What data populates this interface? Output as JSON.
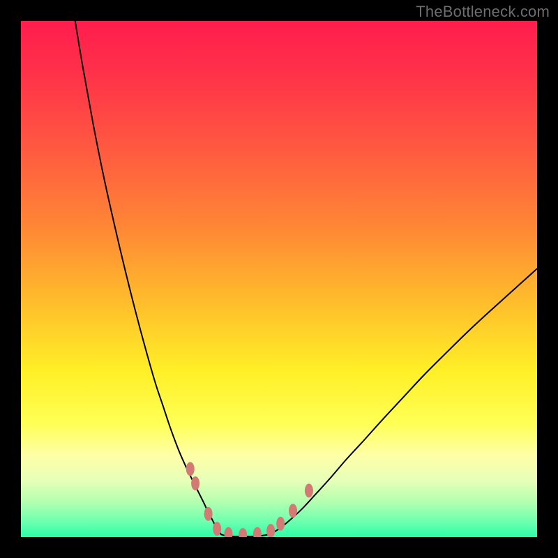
{
  "watermark": "TheBottleneck.com",
  "chart_data": {
    "type": "line",
    "title": "",
    "xlabel": "",
    "ylabel": "",
    "xlim": [
      0,
      100
    ],
    "ylim": [
      0,
      100
    ],
    "background_gradient": {
      "orientation": "vertical",
      "stops": [
        {
          "offset": 0.0,
          "color": "#ff1d4d"
        },
        {
          "offset": 0.1,
          "color": "#ff3149"
        },
        {
          "offset": 0.25,
          "color": "#ff5a40"
        },
        {
          "offset": 0.4,
          "color": "#ff8735"
        },
        {
          "offset": 0.55,
          "color": "#ffbf2b"
        },
        {
          "offset": 0.68,
          "color": "#fff027"
        },
        {
          "offset": 0.78,
          "color": "#ffff56"
        },
        {
          "offset": 0.84,
          "color": "#ffffa6"
        },
        {
          "offset": 0.89,
          "color": "#e7ffb8"
        },
        {
          "offset": 0.93,
          "color": "#b6ffb0"
        },
        {
          "offset": 0.97,
          "color": "#6dffaf"
        },
        {
          "offset": 1.0,
          "color": "#2bffa7"
        }
      ]
    },
    "series": [
      {
        "name": "left-curve",
        "x": [
          10.5,
          12,
          14,
          16,
          18,
          20,
          22,
          24,
          26,
          27.5,
          29,
          30.5,
          31.8,
          33,
          34.5,
          35.5,
          36.2,
          37,
          37.8,
          38.8
        ],
        "y": [
          100,
          91,
          80,
          70,
          61,
          52.5,
          44.5,
          37,
          30,
          25.5,
          21,
          17,
          14,
          11.5,
          8.5,
          6.5,
          5,
          3.5,
          2,
          0.5
        ]
      },
      {
        "name": "valley-floor",
        "x": [
          38.8,
          40,
          41.5,
          43,
          44.5,
          46,
          47.5,
          48.5
        ],
        "y": [
          0.5,
          0.2,
          0.1,
          0.1,
          0.1,
          0.2,
          0.4,
          0.7
        ]
      },
      {
        "name": "right-curve",
        "x": [
          48.5,
          50,
          52,
          54.5,
          57,
          60,
          63,
          66.5,
          70,
          74,
          78,
          82.5,
          87,
          92,
          97,
          100
        ],
        "y": [
          0.7,
          1.6,
          3.2,
          5.5,
          8.2,
          11.5,
          15,
          18.8,
          22.7,
          27,
          31.3,
          35.8,
          40.2,
          44.8,
          49.3,
          52
        ]
      }
    ],
    "markers": {
      "style": {
        "fill": "#d47a75",
        "rx": 6,
        "ry": 10
      },
      "points": [
        {
          "x": 32.8,
          "y": 13.2
        },
        {
          "x": 33.8,
          "y": 10.4
        },
        {
          "x": 36.3,
          "y": 4.5
        },
        {
          "x": 38.0,
          "y": 1.6
        },
        {
          "x": 40.2,
          "y": 0.6
        },
        {
          "x": 43.0,
          "y": 0.4
        },
        {
          "x": 45.8,
          "y": 0.6
        },
        {
          "x": 48.4,
          "y": 1.2
        },
        {
          "x": 50.3,
          "y": 2.6
        },
        {
          "x": 52.7,
          "y": 5.1
        },
        {
          "x": 55.8,
          "y": 9.0
        }
      ]
    }
  }
}
